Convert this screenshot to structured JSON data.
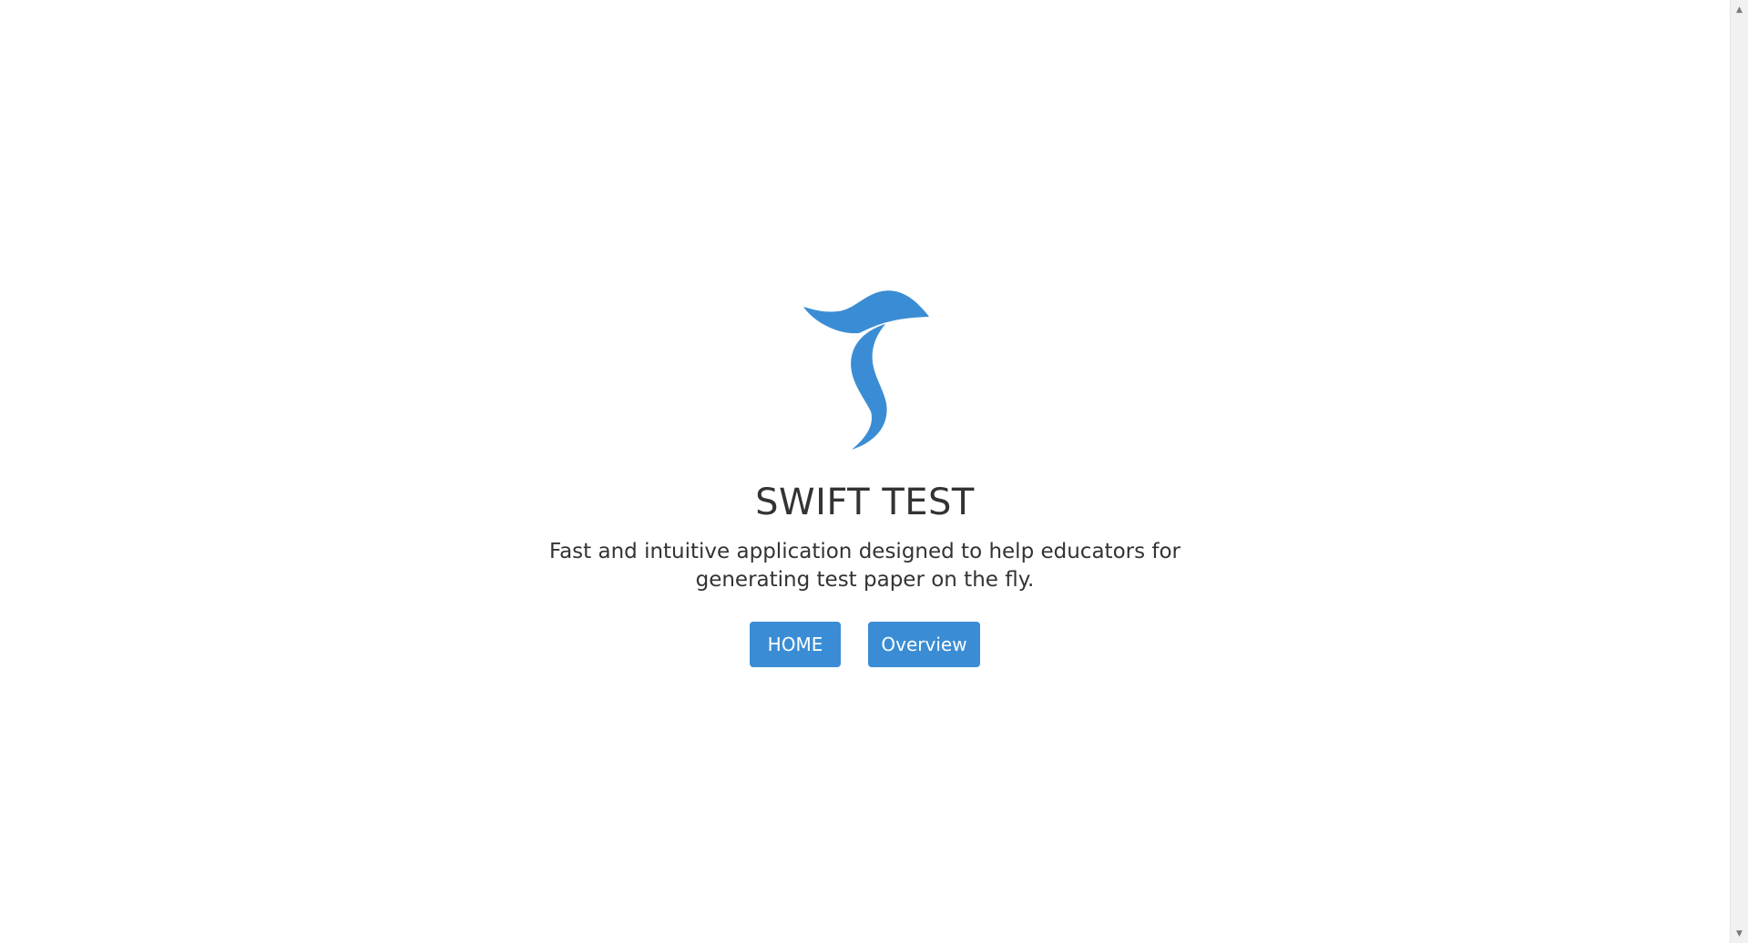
{
  "app": {
    "logo_icon": "swift-bird-logo",
    "brand_color": "#3a8dd4",
    "title": "SWIFT TEST",
    "tagline": "Fast and intuitive application designed to help educators for generating test paper on the fly."
  },
  "actions": {
    "home_label": "HOME",
    "overview_label": "Overview"
  },
  "scrollbar": {
    "up_icon": "▲",
    "down_icon": "▼"
  }
}
